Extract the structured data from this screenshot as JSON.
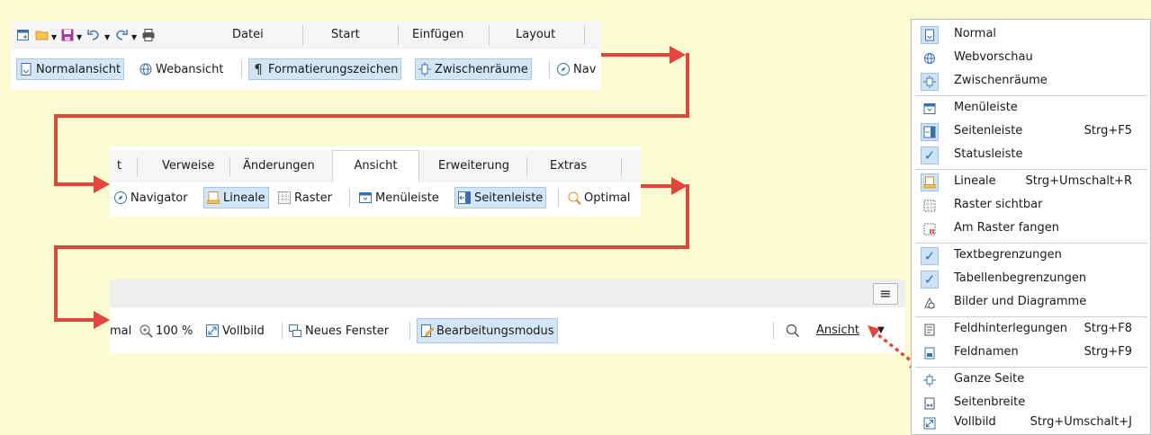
{
  "panel1": {
    "tabs": [
      "Datei",
      "Start",
      "Einfügen",
      "Layout"
    ],
    "tools": [
      "Normalansicht",
      "Webansicht",
      "Formatierungszeichen",
      "Zwischenräume",
      "Nav"
    ]
  },
  "panel2": {
    "tabs": [
      "t",
      "Verweise",
      "Änderungen",
      "Ansicht",
      "Erweiterung",
      "Extras"
    ],
    "tools": [
      "Navigator",
      "Lineale",
      "Raster",
      "Menüleiste",
      "Seitenleiste",
      "Optimal"
    ]
  },
  "panel3": {
    "tools": [
      "mal",
      "100 %",
      "Vollbild",
      "Neues Fenster",
      "Bearbeitungsmodus"
    ],
    "view_label": "Ansicht"
  },
  "menu": {
    "items": [
      {
        "label": "Normal",
        "shortcut": "",
        "icon": "normal-page-icon"
      },
      {
        "label": "Webvorschau",
        "shortcut": "",
        "icon": "globe-icon"
      },
      {
        "label": "Zwischenräume",
        "shortcut": "",
        "icon": "whitespace-icon"
      },
      {
        "label": "Menüleiste",
        "shortcut": "",
        "icon": "menubar-icon"
      },
      {
        "label": "Seitenleiste",
        "shortcut": "Strg+F5",
        "icon": "sidebar-icon"
      },
      {
        "label": "Statusleiste",
        "shortcut": "",
        "icon": "check-icon"
      },
      {
        "label": "Lineale",
        "shortcut": "Strg+Umschalt+R",
        "icon": "ruler-icon"
      },
      {
        "label": "Raster sichtbar",
        "shortcut": "",
        "icon": "grid-icon"
      },
      {
        "label": "Am Raster fangen",
        "shortcut": "",
        "icon": "snap-grid-icon"
      },
      {
        "label": "Textbegrenzungen",
        "shortcut": "",
        "icon": "check-icon"
      },
      {
        "label": "Tabellenbegrenzungen",
        "shortcut": "",
        "icon": "check-icon"
      },
      {
        "label": "Bilder und Diagramme",
        "shortcut": "",
        "icon": "images-icon"
      },
      {
        "label": "Feldhinterlegungen",
        "shortcut": "Strg+F8",
        "icon": "field-shading-icon"
      },
      {
        "label": "Feldnamen",
        "shortcut": "Strg+F9",
        "icon": "field-names-icon"
      },
      {
        "label": "Ganze Seite",
        "shortcut": "",
        "icon": "whole-page-icon"
      },
      {
        "label": "Seitenbreite",
        "shortcut": "",
        "icon": "page-width-icon"
      },
      {
        "label": "Vollbild",
        "shortcut": "Strg+Umschalt+J",
        "icon": "fullscreen-icon"
      }
    ]
  },
  "colors": {
    "background": "#fbfbd2",
    "arrow": "#e0463a",
    "highlight": "#d3e6f6",
    "accent": "#2a6bc8"
  }
}
